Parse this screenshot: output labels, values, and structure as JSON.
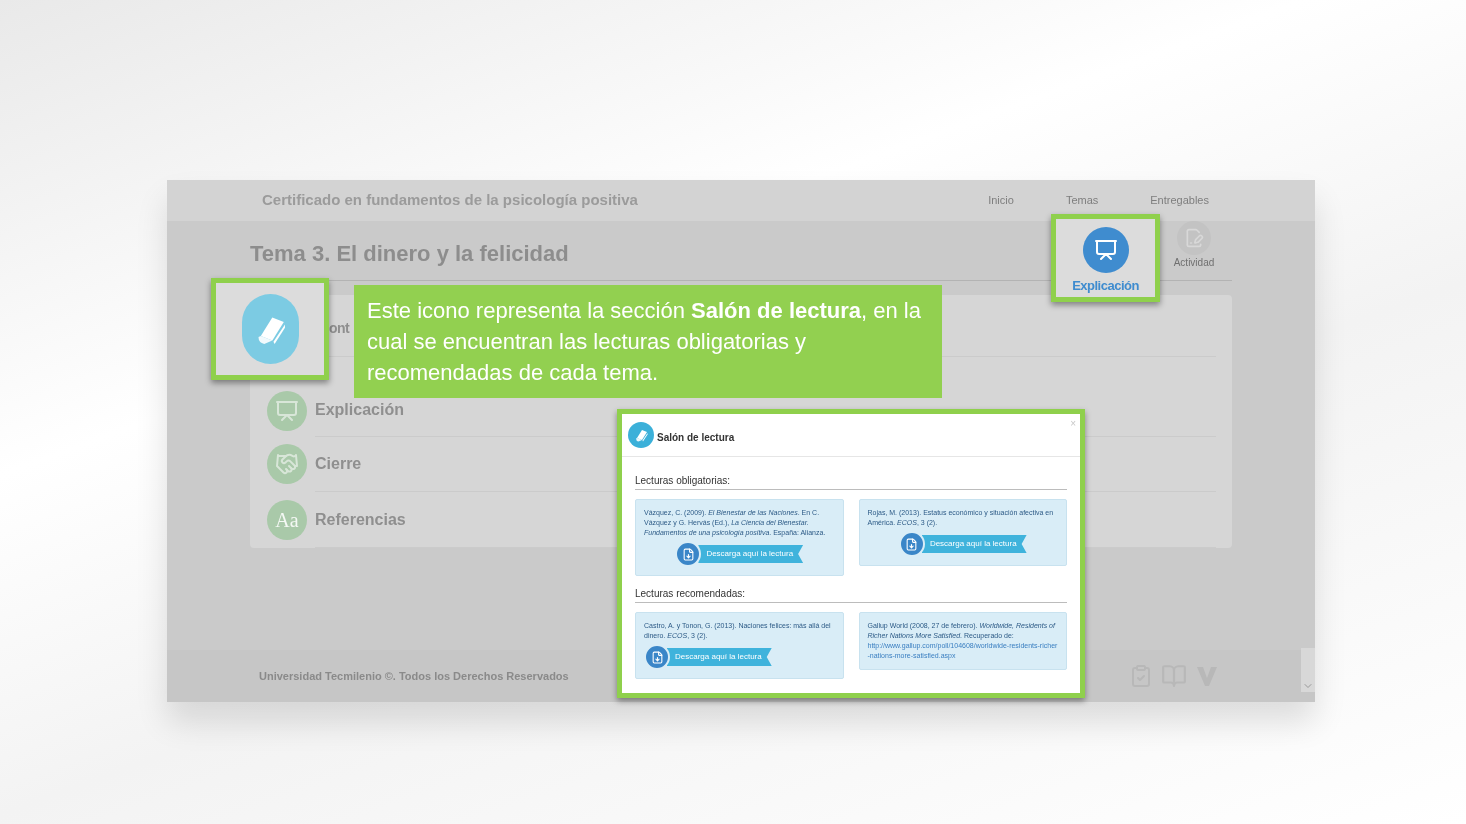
{
  "header": {
    "course_title": "Certificado en fundamentos de la psicología positiva",
    "nav": [
      {
        "label": "Inicio"
      },
      {
        "label": "Temas"
      },
      {
        "label": "Entregables"
      }
    ]
  },
  "topic_title": "Tema 3. El dinero y la felicidad",
  "tabs": [
    {
      "label": "Explicación",
      "highlighted": true,
      "kind": "presenter"
    },
    {
      "label": "Actividad",
      "highlighted": false,
      "kind": "activity"
    }
  ],
  "sections": [
    {
      "label": "ont"
    },
    {
      "label": "Explicación",
      "kind": "presenter"
    },
    {
      "label": "Cierre",
      "kind": "handshake"
    },
    {
      "label": "Referencias",
      "kind": "letters",
      "icon_text": "Aa"
    }
  ],
  "callout": {
    "text": "Este icono representa la sección **Salón de lectura**, en la cual se encuentran las lecturas obligatorias y recomendadas de cada tema."
  },
  "modal": {
    "title": "Salón de lectura",
    "close": "×",
    "groups": [
      {
        "heading": "Lecturas obligatorias:",
        "readings": [
          {
            "citation": "Vázquez, C. (2009). *El Bienestar de las Naciones*. En C. Vázquez y G. Hervás (Ed.), *La Ciencia del Bienestar. Fundamentos de una psicología positiva*. España: Alianza.",
            "download": "Descarga aquí la lectura"
          },
          {
            "citation": "Rojas, M. (2013). Estatus económico y situación afectiva en América. *ECOS*, 3 (2).",
            "download": "Descarga aquí la lectura"
          }
        ]
      },
      {
        "heading": "Lecturas recomendadas:",
        "readings": [
          {
            "citation": "Castro, A. y Tonon, G. (2013). Naciones felices: más allá del dinero. *ECOS*, 3 (2).",
            "download": "Descarga aquí la lectura"
          },
          {
            "citation": "Gallup World (2008, 27 de febrero). *Worldwide, Residents of Richer Nations More Satisfied*. Recuperado de:",
            "url": "http://www.gallup.com/poll/104608/worldwide-residents-richer-nations-more-satisfied.aspx"
          }
        ]
      }
    ]
  },
  "footer": {
    "copyright": "Universidad Tecmilenio ©. Todos los Derechos Reservados"
  }
}
